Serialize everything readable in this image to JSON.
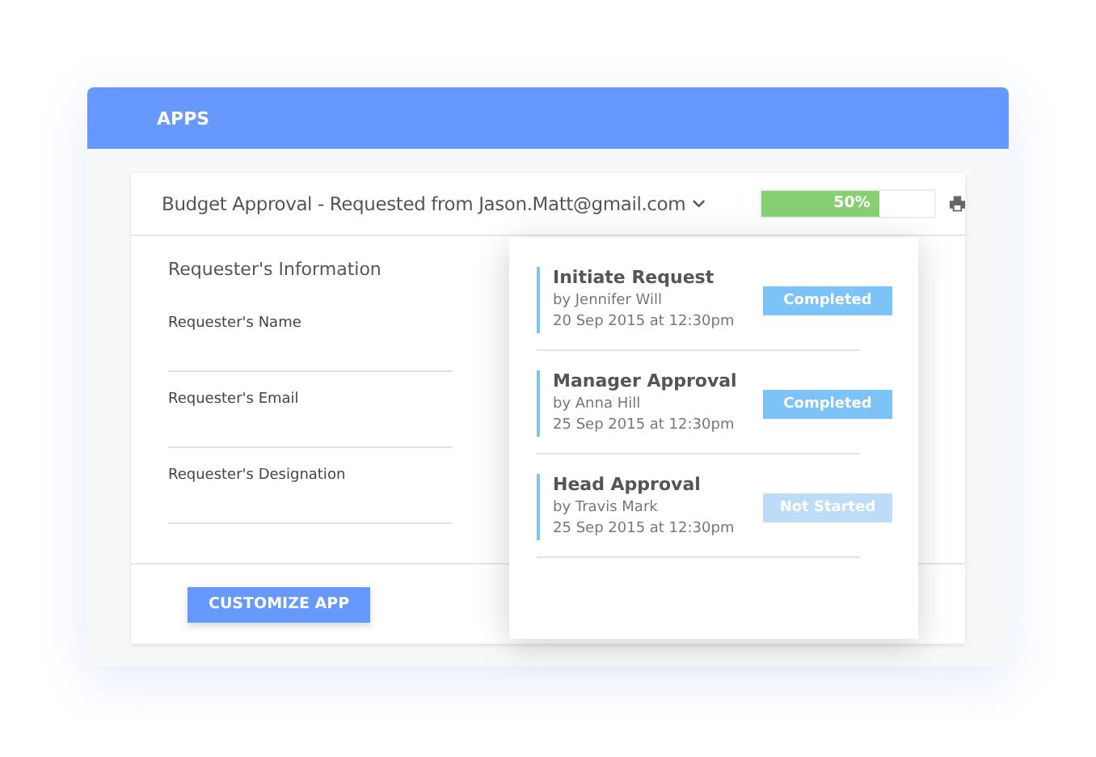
{
  "header": {
    "title": "APPS"
  },
  "request": {
    "title": "Budget Approval - Requested from Jason.Matt@gmail.com",
    "progress": {
      "label": "50%",
      "level": 0.69
    }
  },
  "form": {
    "heading": "Requester's Information",
    "fields": [
      {
        "label": "Requester's Name"
      },
      {
        "label": "Requester's Email"
      },
      {
        "label": "Requester's Designation"
      }
    ]
  },
  "button": "CUSTOMIZE APP",
  "steps": [
    {
      "title": "Initiate Request",
      "by": "by Jennifer Will",
      "date": "20 Sep 2015 at 12:30pm",
      "status": "Completed",
      "kind": "completed"
    },
    {
      "title": "Manager Approval",
      "by": "by Anna Hill",
      "date": "25 Sep 2015 at 12:30pm",
      "status": "Completed",
      "kind": "completed"
    },
    {
      "title": "Head Approval",
      "by": "by Travis Mark",
      "date": "25 Sep 2015 at 12:30pm",
      "status": "Not Started",
      "kind": "not_started"
    }
  ]
}
